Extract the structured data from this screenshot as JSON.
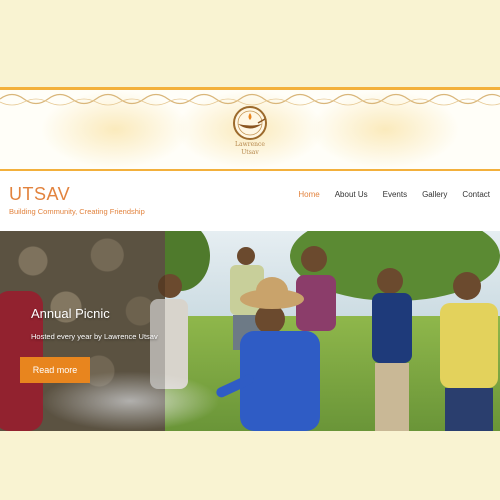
{
  "banner": {
    "logo_name": "Lawrence",
    "logo_sub": "Utsav"
  },
  "header": {
    "brand": "UTSAV",
    "tagline": "Building Community, Creating Friendship"
  },
  "nav": {
    "items": [
      {
        "label": "Home",
        "active": true
      },
      {
        "label": "About Us",
        "active": false
      },
      {
        "label": "Events",
        "active": false
      },
      {
        "label": "Gallery",
        "active": false
      },
      {
        "label": "Contact",
        "active": false
      }
    ]
  },
  "hero": {
    "title": "Annual Picnic",
    "subtitle": "Hosted every year by Lawrence Utsav",
    "button_label": "Read more"
  },
  "colors": {
    "accent": "#e2833e",
    "button": "#e8851e",
    "banner_border": "#f3b03b",
    "page_bg": "#f9f3d2"
  }
}
